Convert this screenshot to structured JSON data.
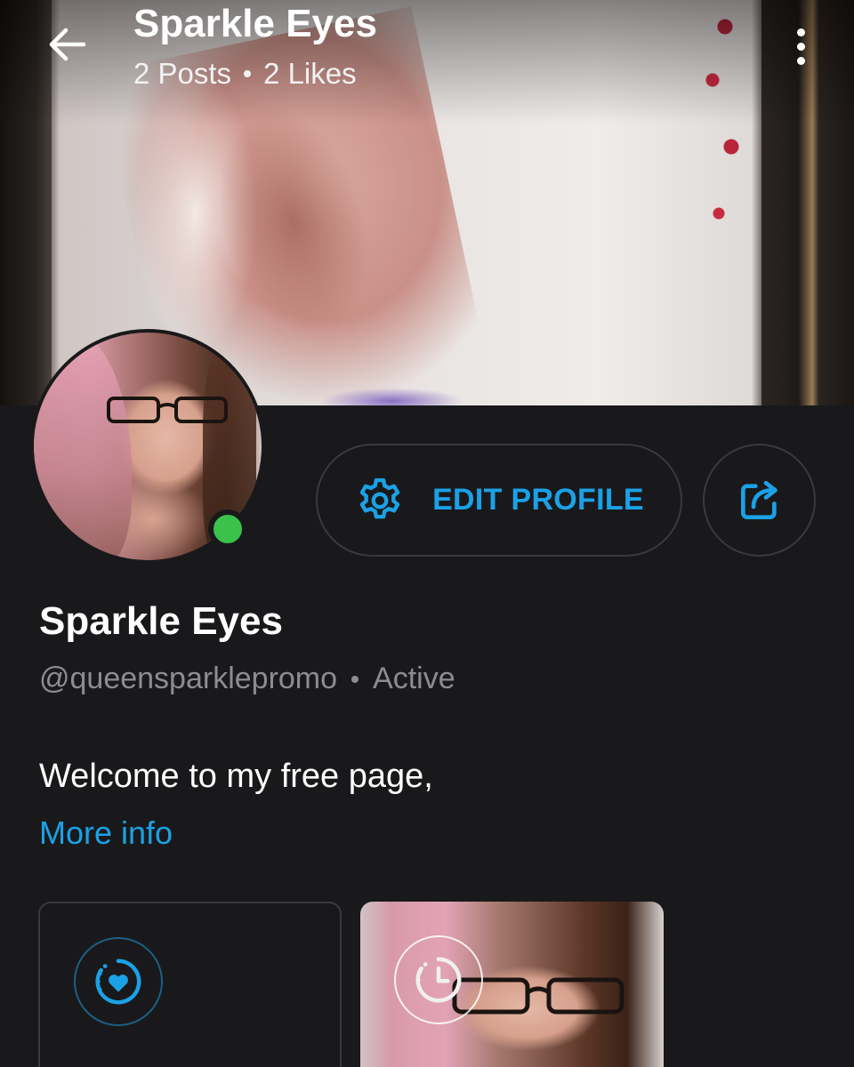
{
  "header": {
    "title": "Sparkle Eyes",
    "posts": "2 Posts",
    "likes": "2 Likes"
  },
  "actions": {
    "edit_profile": "EDIT PROFILE"
  },
  "profile": {
    "name": "Sparkle Eyes",
    "handle": "@queensparklepromo",
    "status": "Active",
    "bio": "Welcome to my free page,",
    "more_info": "More info"
  },
  "icons": {
    "back": "back-arrow-icon",
    "menu": "more-vertical-icon",
    "settings": "gear-icon",
    "share": "share-icon",
    "story_add": "heart-story-icon",
    "story": "clock-story-icon"
  },
  "colors": {
    "accent": "#1ba1e6",
    "background": "#19191b",
    "online": "#3ac24a",
    "muted_text": "#8b8d93"
  }
}
